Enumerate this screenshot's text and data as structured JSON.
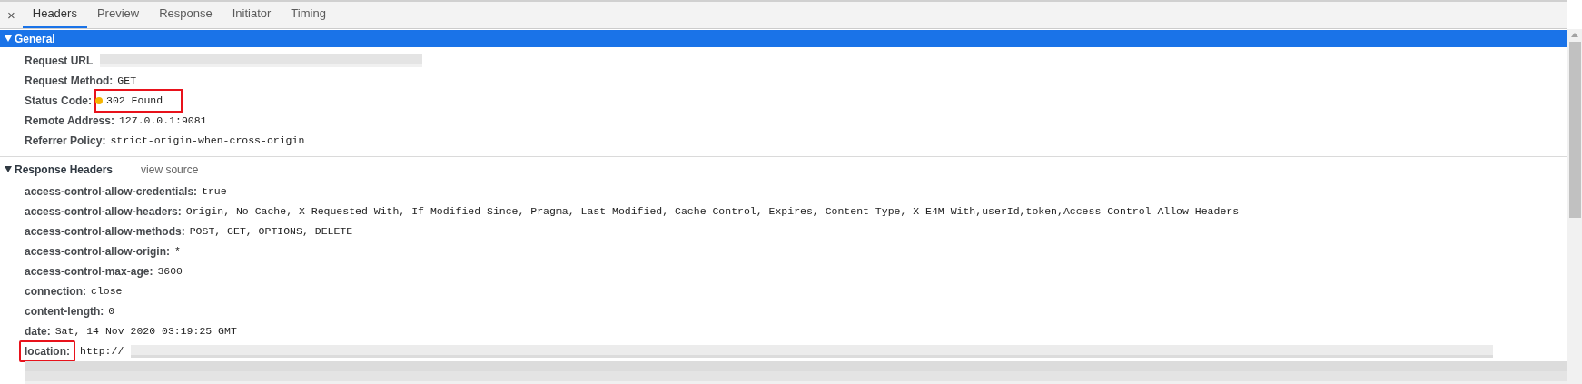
{
  "close_button": {
    "label": "×"
  },
  "tabs": [
    {
      "label": "Headers",
      "selected": true
    },
    {
      "label": "Preview",
      "selected": false
    },
    {
      "label": "Response",
      "selected": false
    },
    {
      "label": "Initiator",
      "selected": false
    },
    {
      "label": "Timing",
      "selected": false
    }
  ],
  "sections": [
    {
      "title": "General",
      "expanded": true,
      "selected": true,
      "rows": [
        {
          "name": "Request URL",
          "redacted": true
        },
        {
          "name": "Request Method:",
          "value": "GET"
        },
        {
          "name": "Status Code:",
          "value": "302 Found",
          "color": "#f5b400",
          "value_highlighted": true
        },
        {
          "name": "Remote Address:",
          "value": "127.0.0.1:9081"
        },
        {
          "name": "Referrer Policy:",
          "value": "strict-origin-when-cross-origin"
        }
      ]
    },
    {
      "title": "Response Headers",
      "link": "view source",
      "expanded": true,
      "selected": false,
      "rows": [
        {
          "name": "access-control-allow-credentials:",
          "value": "true"
        },
        {
          "name": "access-control-allow-headers:",
          "value": "Origin, No-Cache, X-Requested-With, If-Modified-Since, Pragma, Last-Modified, Cache-Control, Expires, Content-Type, X-E4M-With,userId,token,Access-Control-Allow-Headers"
        },
        {
          "name": "access-control-allow-methods:",
          "value": "POST, GET, OPTIONS, DELETE"
        },
        {
          "name": "access-control-allow-origin:",
          "value": "*"
        },
        {
          "name": "access-control-max-age:",
          "value": "3600"
        },
        {
          "name": "connection:",
          "value": "close"
        },
        {
          "name": "content-length:",
          "value": "0"
        },
        {
          "name": "date:",
          "value": "Sat, 14 Nov 2020 03:19:25 GMT"
        },
        {
          "name": "location:",
          "value": "http://",
          "redacted": true,
          "name_highlighted": true
        }
      ]
    }
  ]
}
